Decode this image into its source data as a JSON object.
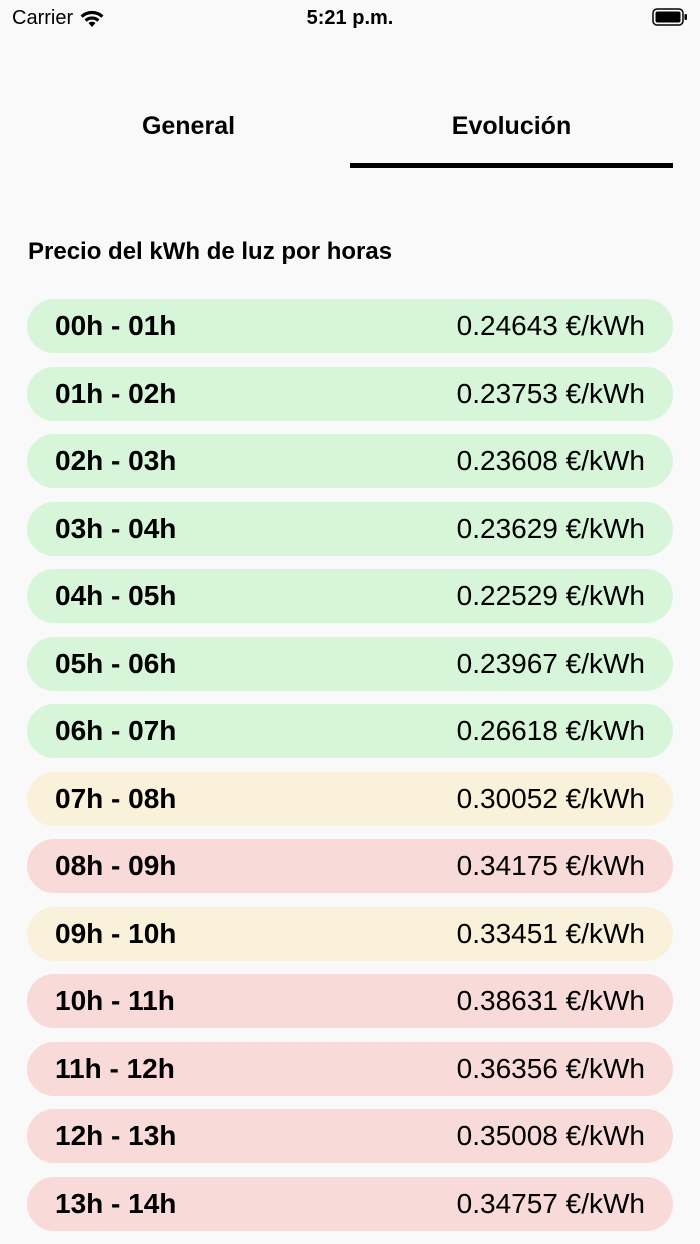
{
  "status_bar": {
    "carrier": "Carrier",
    "time": "5:21 p.m."
  },
  "tabs": {
    "general": "General",
    "evolucion": "Evolución",
    "active": "evolucion"
  },
  "section_title": "Precio del kWh de luz por horas",
  "colors": {
    "green": "#d7f5d9",
    "yellow": "#f9f1d9",
    "red": "#f8dad9"
  },
  "rows": [
    {
      "hours": "00h - 01h",
      "price": "0.24643 €/kWh",
      "level": "green"
    },
    {
      "hours": "01h - 02h",
      "price": "0.23753 €/kWh",
      "level": "green"
    },
    {
      "hours": "02h - 03h",
      "price": "0.23608 €/kWh",
      "level": "green"
    },
    {
      "hours": "03h - 04h",
      "price": "0.23629 €/kWh",
      "level": "green"
    },
    {
      "hours": "04h - 05h",
      "price": "0.22529 €/kWh",
      "level": "green"
    },
    {
      "hours": "05h - 06h",
      "price": "0.23967 €/kWh",
      "level": "green"
    },
    {
      "hours": "06h - 07h",
      "price": "0.26618 €/kWh",
      "level": "green"
    },
    {
      "hours": "07h - 08h",
      "price": "0.30052 €/kWh",
      "level": "yellow"
    },
    {
      "hours": "08h - 09h",
      "price": "0.34175 €/kWh",
      "level": "red"
    },
    {
      "hours": "09h - 10h",
      "price": "0.33451 €/kWh",
      "level": "yellow"
    },
    {
      "hours": "10h - 11h",
      "price": "0.38631 €/kWh",
      "level": "red"
    },
    {
      "hours": "11h - 12h",
      "price": "0.36356 €/kWh",
      "level": "red"
    },
    {
      "hours": "12h - 13h",
      "price": "0.35008 €/kWh",
      "level": "red"
    },
    {
      "hours": "13h - 14h",
      "price": "0.34757 €/kWh",
      "level": "red"
    }
  ]
}
